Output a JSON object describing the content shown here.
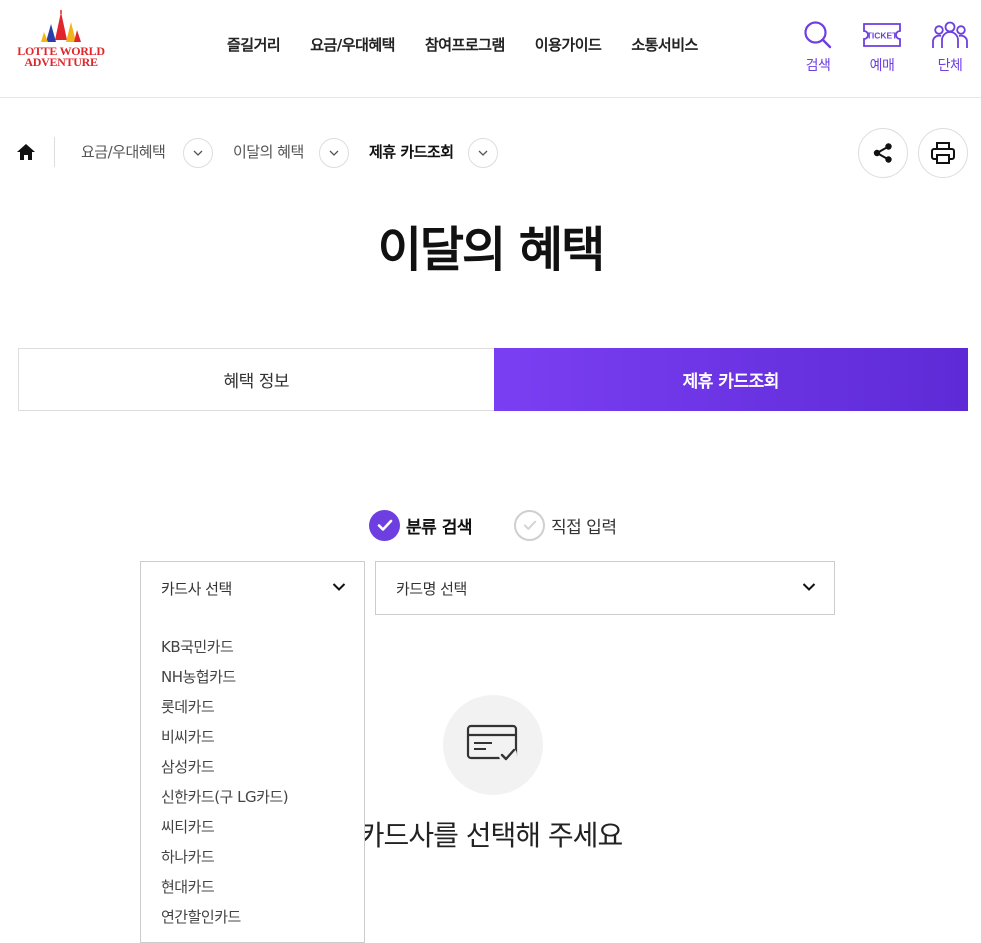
{
  "brand": {
    "logo_lines": [
      "LOTTE WORLD",
      "ADVENTURE"
    ],
    "logo_color": "#e0262b"
  },
  "gnb": [
    "즐길거리",
    "요금/우대혜택",
    "참여프로그램",
    "이용가이드",
    "소통서비스"
  ],
  "utility": {
    "search": "검색",
    "ticket_badge": "TICKET",
    "booking": "예매",
    "group": "단체"
  },
  "breadcrumb": {
    "level1": "요금/우대혜택",
    "level2": "이달의 혜택",
    "current": "제휴 카드조회"
  },
  "page_title": "이달의 혜택",
  "tabs": [
    {
      "label": "혜택 정보",
      "active": false
    },
    {
      "label": "제휴 카드조회",
      "active": true
    }
  ],
  "search_mode": {
    "category": "분류 검색",
    "direct": "직접 입력",
    "selected": "category"
  },
  "card_company_select": {
    "placeholder": "카드사 선택",
    "options": [
      "KB국민카드",
      "NH농협카드",
      "롯데카드",
      "비씨카드",
      "삼성카드",
      "신한카드(구 LG카드)",
      "씨티카드",
      "하나카드",
      "현대카드",
      "연간할인카드"
    ]
  },
  "card_name_select": {
    "placeholder": "카드명 선택"
  },
  "empty_message": "카드사를 선택해 주세요",
  "colors": {
    "accent": "#6d3fe0",
    "tab_gradient_start": "#7a3ff2",
    "tab_gradient_end": "#5e2ad6"
  }
}
